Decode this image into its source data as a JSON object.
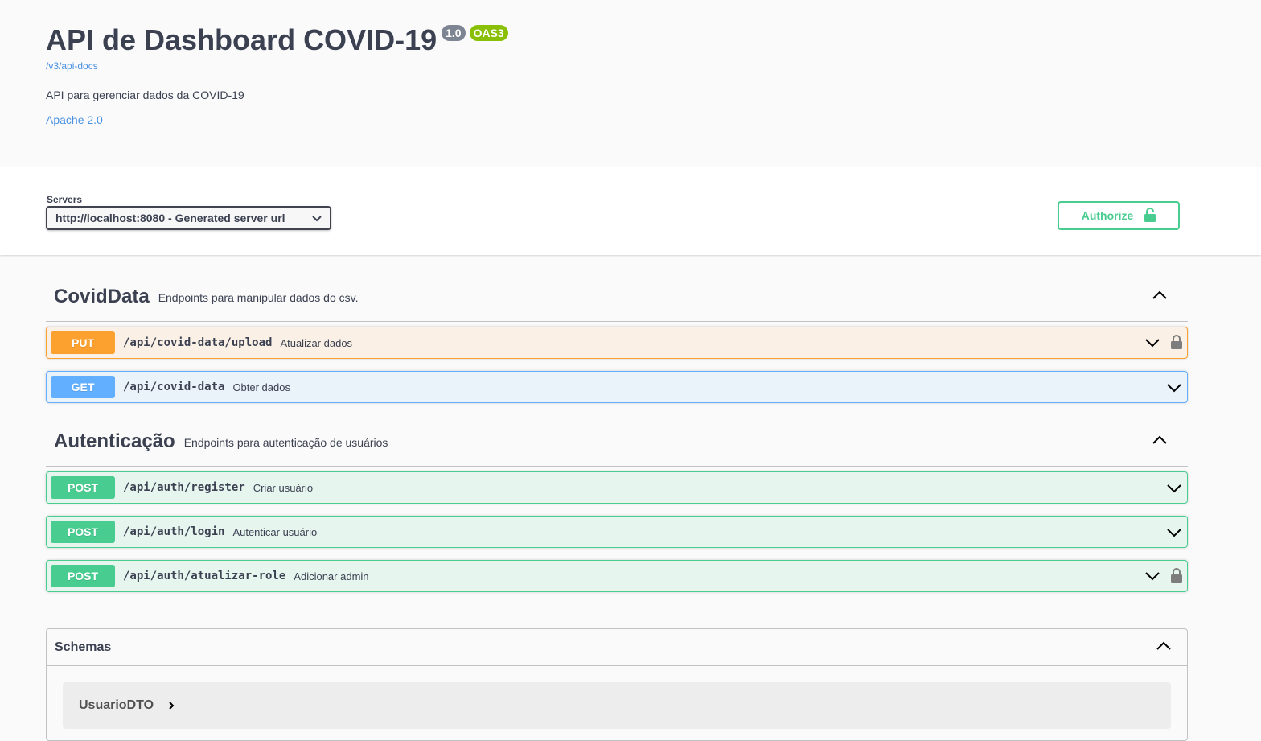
{
  "info": {
    "title": "API de Dashboard COVID-19",
    "version": "1.0",
    "oas_badge": "OAS3",
    "spec_url": "/v3/api-docs",
    "description": "API para gerenciar dados da COVID-19",
    "license": "Apache 2.0"
  },
  "servers": {
    "label": "Servers",
    "selected": "http://localhost:8080 - Generated server url"
  },
  "authorize": {
    "label": "Authorize"
  },
  "tags": [
    {
      "name": "CovidData",
      "description": "Endpoints para manipular dados do csv.",
      "operations": [
        {
          "method": "PUT",
          "path": "/api/covid-data/upload",
          "summary": "Atualizar dados",
          "locked": true
        },
        {
          "method": "GET",
          "path": "/api/covid-data",
          "summary": "Obter dados",
          "locked": false
        }
      ]
    },
    {
      "name": "Autenticação",
      "description": "Endpoints para autenticação de usuários",
      "operations": [
        {
          "method": "POST",
          "path": "/api/auth/register",
          "summary": "Criar usuário",
          "locked": false
        },
        {
          "method": "POST",
          "path": "/api/auth/login",
          "summary": "Autenticar usuário",
          "locked": false
        },
        {
          "method": "POST",
          "path": "/api/auth/atualizar-role",
          "summary": "Adicionar admin",
          "locked": true
        }
      ]
    }
  ],
  "schemas": {
    "title": "Schemas",
    "items": [
      "UsuarioDTO"
    ]
  },
  "colors": {
    "put": "#fca130",
    "get": "#61affe",
    "post": "#49cc90",
    "link": "#4990e2",
    "text": "#3b4151"
  }
}
